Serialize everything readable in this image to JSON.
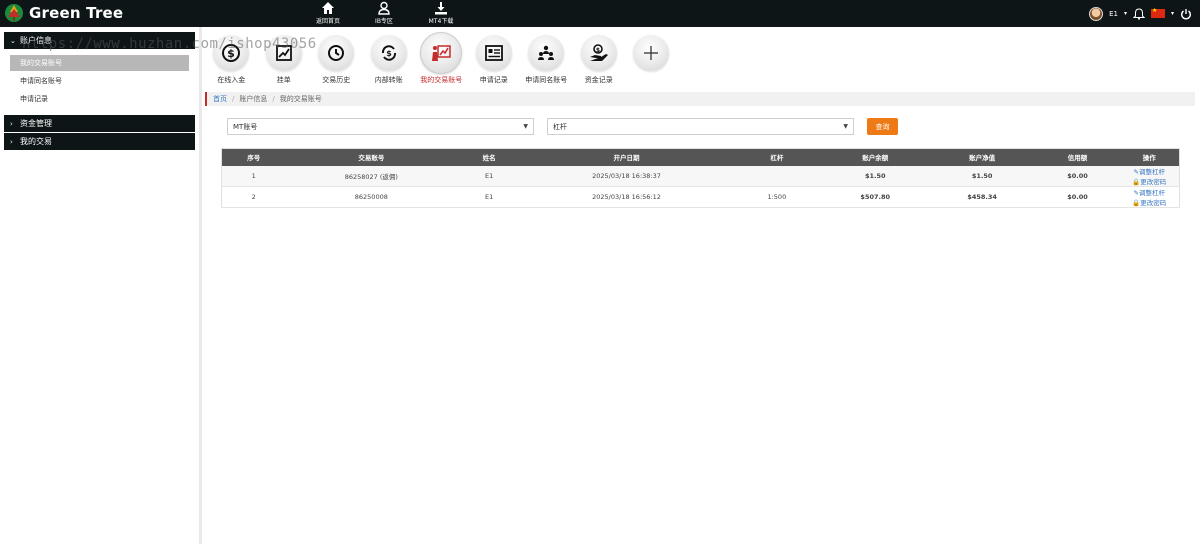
{
  "brand": {
    "name": "Green Tree"
  },
  "topnav": [
    {
      "label": "返回首页",
      "icon": "home-icon"
    },
    {
      "label": "IB专区",
      "icon": "user-icon"
    },
    {
      "label": "MT4下载",
      "icon": "download-icon"
    }
  ],
  "user": {
    "name": "E1"
  },
  "sidebar": {
    "groups": [
      {
        "label": "账户信息",
        "items": [
          "我的交易账号",
          "申请同名账号",
          "申请记录"
        ]
      },
      {
        "label": "资金管理"
      },
      {
        "label": "我的交易"
      }
    ]
  },
  "toolbar": [
    {
      "label": "在线入金",
      "icon": "dollar-circle-icon"
    },
    {
      "label": "挂单",
      "icon": "chart-edit-icon"
    },
    {
      "label": "交易历史",
      "icon": "history-icon"
    },
    {
      "label": "内部转账",
      "icon": "transfer-icon"
    },
    {
      "label": "我的交易账号",
      "icon": "trading-account-icon"
    },
    {
      "label": "申请记录",
      "icon": "record-list-icon"
    },
    {
      "label": "申请同名账号",
      "icon": "users-icon"
    },
    {
      "label": "资金记录",
      "icon": "money-hand-icon"
    },
    {
      "label": "",
      "icon": "plus-icon"
    }
  ],
  "breadcrumb": [
    "首页",
    "账户信息",
    "我的交易账号"
  ],
  "filters": {
    "account_select": "MT账号",
    "leverage_select": "杠杆",
    "query_button": "查询"
  },
  "table": {
    "headers": [
      "序号",
      "交易账号",
      "姓名",
      "开户日期",
      "杠杆",
      "账户余额",
      "账户净值",
      "信用额",
      "操作"
    ],
    "rows": [
      {
        "no": "1",
        "account": "86258027 (返佣)",
        "name": "E1",
        "date": "2025/03/18 16:38:37",
        "leverage": "",
        "balance": "$1.50",
        "equity": "$1.50",
        "credit": "$0.00"
      },
      {
        "no": "2",
        "account": "86250008",
        "name": "E1",
        "date": "2025/03/18 16:56:12",
        "leverage": "1:500",
        "balance": "$507.80",
        "equity": "$458.34",
        "credit": "$0.00"
      }
    ],
    "actions": {
      "adjust": "调整杠杆",
      "change_pwd": "更改密码"
    }
  },
  "watermark": "https://www.huzhan.com/ishop43056",
  "colors": {
    "topbar": "#0d1517",
    "accent": "#c62b2b",
    "query": "#ee7a16",
    "money": "#1aa34a",
    "link": "#3a78c5"
  }
}
